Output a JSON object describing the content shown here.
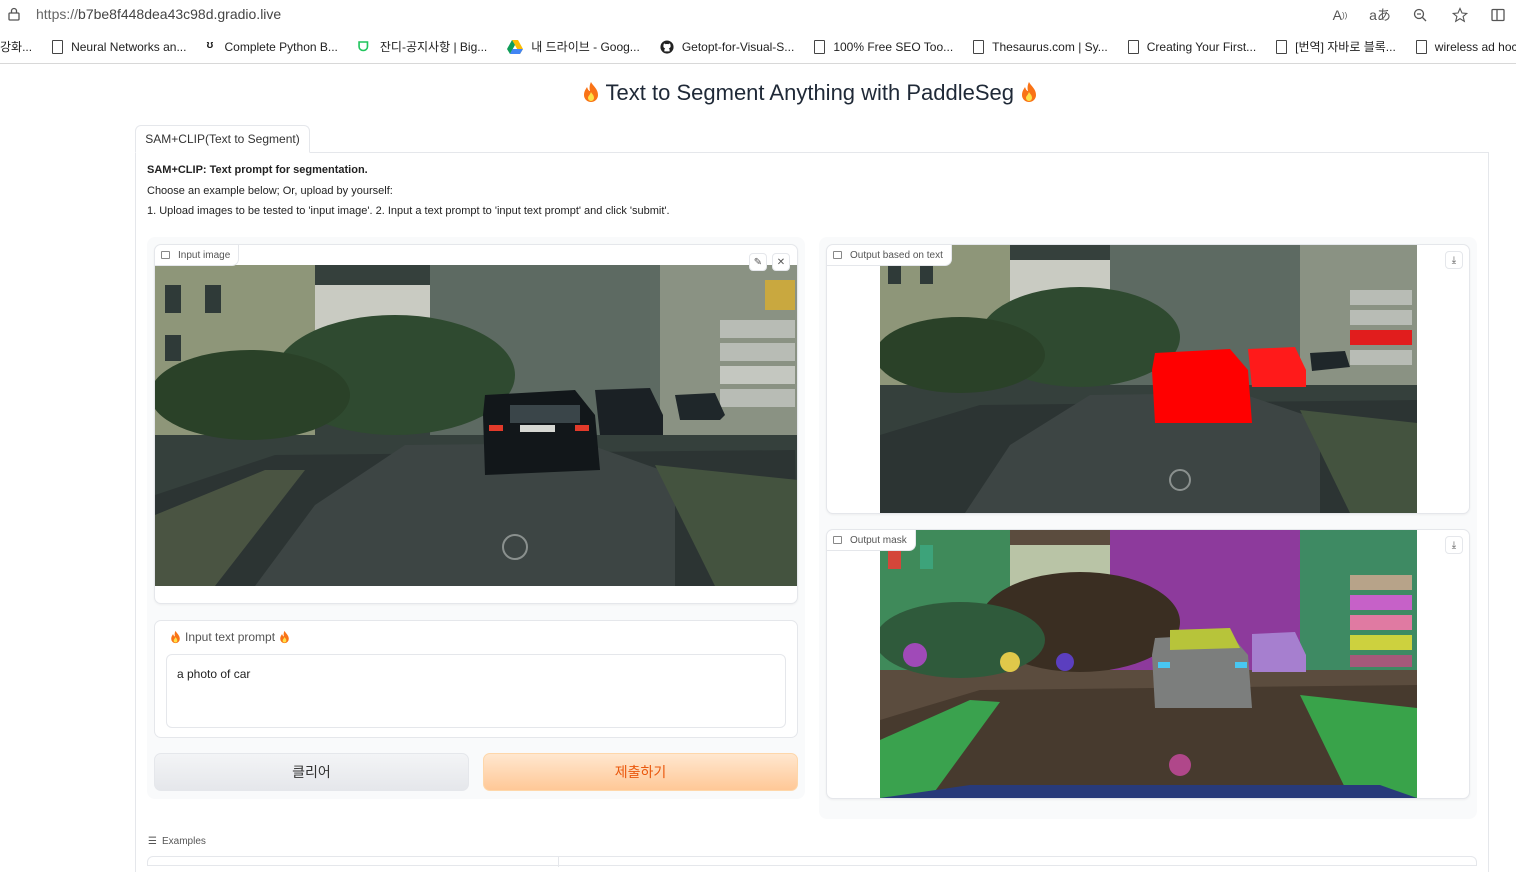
{
  "browser": {
    "url_scheme": "https://",
    "url_host": "b7be8f448dea43c98d.gradio.live",
    "icons": [
      "read-aloud-icon",
      "translate-icon",
      "zoom-icon",
      "favorite-star-icon",
      "split-screen-icon"
    ],
    "bookmarks": [
      {
        "label": "강화...",
        "icon": "none"
      },
      {
        "label": "Neural Networks an...",
        "icon": "doc"
      },
      {
        "label": "Complete Python B...",
        "icon": "udemy"
      },
      {
        "label": "잔디-공지사항 | Big...",
        "icon": "jandi"
      },
      {
        "label": "내 드라이브 - Goog...",
        "icon": "drive"
      },
      {
        "label": "Getopt-for-Visual-S...",
        "icon": "github"
      },
      {
        "label": "100% Free SEO Too...",
        "icon": "doc"
      },
      {
        "label": "Thesaurus.com | Sy...",
        "icon": "doc"
      },
      {
        "label": "Creating Your First...",
        "icon": "doc"
      },
      {
        "label": "[번역] 자바로 블록...",
        "icon": "doc"
      },
      {
        "label": "wireless ad hoc",
        "icon": "doc"
      }
    ]
  },
  "app": {
    "title": "Text to Segment Anything with PaddleSeg",
    "tab_label": "SAM+CLIP(Text to Segment)",
    "desc_title": "SAM+CLIP: Text prompt for segmentation.",
    "desc_line1": "Choose an example below; Or, upload by yourself:",
    "desc_line2": "1. Upload images to be tested to 'input image'. 2. Input a text prompt to 'input text prompt' and click 'submit'.",
    "input_image_label": "Input image",
    "output_text_label": "Output based on text",
    "output_mask_label": "Output mask",
    "prompt_label": "Input text prompt",
    "prompt_value": "a photo of car",
    "clear_label": "클리어",
    "submit_label": "제출하기",
    "examples_label": "Examples",
    "accent_color": "#ea580c"
  }
}
